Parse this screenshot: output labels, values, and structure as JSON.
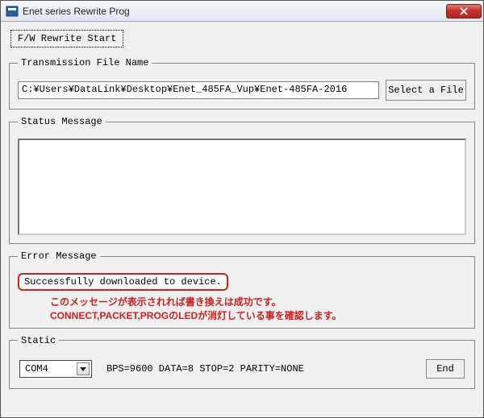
{
  "titlebar": {
    "title": "Enet series Rewrite Prog"
  },
  "buttons": {
    "rewrite_start": "F/W Rewrite Start",
    "select_file": "Select a File",
    "end": "End"
  },
  "groups": {
    "transmission": "Transmission File Name",
    "status": "Status Message",
    "error": "Error Message",
    "static": "Static"
  },
  "file": {
    "path": "C:¥Users¥DataLink¥Desktop¥Enet_485FA_Vup¥Enet-485FA-2016"
  },
  "status": {
    "text": ""
  },
  "error": {
    "text": "Successfully downloaded to device."
  },
  "annotation": {
    "line1": "このメッセージが表示されれば書き換えは成功です。",
    "line2": "CONNECT,PACKET,PROGのLEDが消灯している事を確認します。"
  },
  "static": {
    "port": "COM4",
    "params": "BPS=9600  DATA=8  STOP=2  PARITY=NONE"
  }
}
